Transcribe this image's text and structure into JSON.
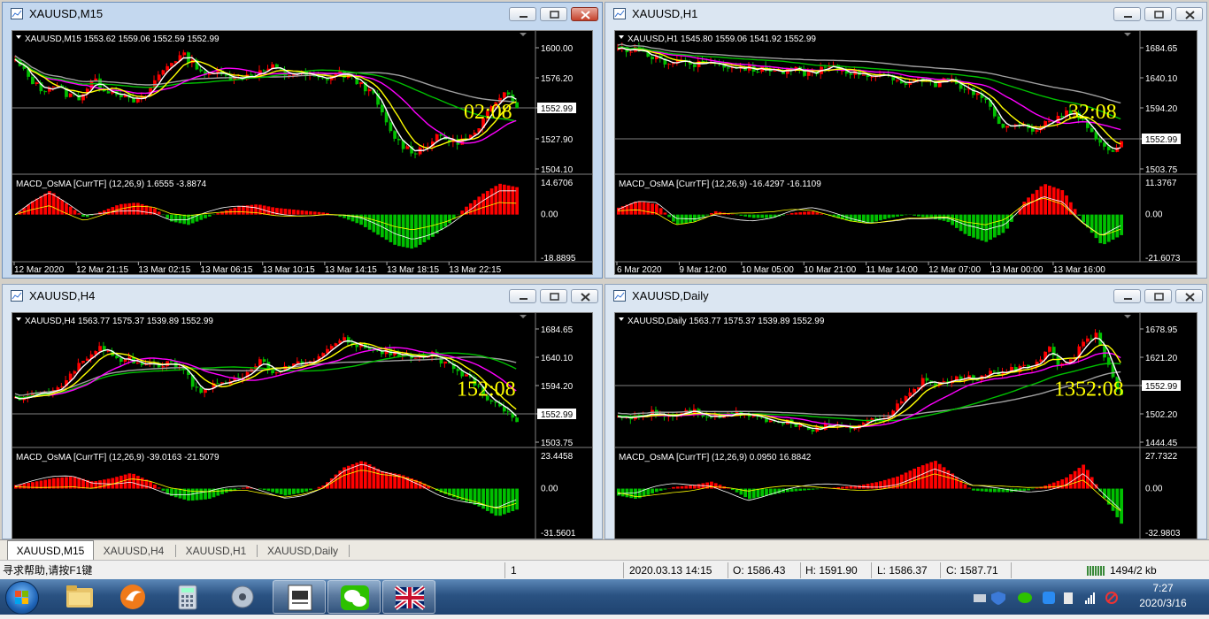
{
  "windows": [
    {
      "title": "XAUUSD,M15",
      "info": "XAUUSD,M15  1553.62 1559.06 1552.59 1552.99",
      "price_labels": [
        "1600.00",
        "1576.20",
        "1552.99",
        "1527.90",
        "1504.10"
      ],
      "current_price": "1552.99",
      "countdown": "02:08",
      "macd_label": "MACD_OsMA [CurrTF] (12,26,9) 1.6555 -3.8874",
      "macd_labels": [
        "14.6706",
        "0.00",
        "-18.8895"
      ],
      "time_labels": [
        "12 Mar 2020",
        "12 Mar 21:15",
        "13 Mar 02:15",
        "13 Mar 06:15",
        "13 Mar 10:15",
        "13 Mar 14:15",
        "13 Mar 18:15",
        "13 Mar 22:15"
      ]
    },
    {
      "title": "XAUUSD,H1",
      "info": "XAUUSD,H1  1545.80 1559.06 1541.92 1552.99",
      "price_labels": [
        "1684.65",
        "1640.10",
        "1594.20",
        "1552.99",
        "1503.75"
      ],
      "current_price": "1552.99",
      "countdown": "32:08",
      "macd_label": "MACD_OsMA [CurrTF] (12,26,9) -16.4297 -16.1109",
      "macd_labels": [
        "11.3767",
        "0.00",
        "-21.6073"
      ],
      "time_labels": [
        "6 Mar 2020",
        "9 Mar 12:00",
        "10 Mar 05:00",
        "10 Mar 21:00",
        "11 Mar 14:00",
        "12 Mar 07:00",
        "13 Mar 00:00",
        "13 Mar 16:00"
      ]
    },
    {
      "title": "XAUUSD,H4",
      "info": "XAUUSD,H4  1563.77 1575.37 1539.89 1552.99",
      "price_labels": [
        "1684.65",
        "1640.10",
        "1594.20",
        "1552.99",
        "1503.75"
      ],
      "current_price": "1552.99",
      "countdown": "152:08",
      "macd_label": "MACD_OsMA [CurrTF] (12,26,9) -39.0163 -21.5079",
      "macd_labels": [
        "23.4458",
        "0.00",
        "-31.5601"
      ],
      "time_labels": []
    },
    {
      "title": "XAUUSD,Daily",
      "info": "XAUUSD,Daily  1563.77 1575.37 1539.89 1552.99",
      "price_labels": [
        "1678.95",
        "1621.20",
        "1552.99",
        "1502.20",
        "1444.45"
      ],
      "current_price": "1552.99",
      "countdown": "1352:08",
      "macd_label": "MACD_OsMA [CurrTF] (12,26,9) 0.0950 16.8842",
      "macd_labels": [
        "27.7322",
        "0.00",
        "-32.9803"
      ],
      "time_labels": []
    }
  ],
  "tabs": [
    "XAUUSD,M15",
    "XAUUSD,H4",
    "XAUUSD,H1",
    "XAUUSD,Daily"
  ],
  "status": {
    "help": "寻求帮助,请按F1键",
    "profile": "1",
    "datetime": "2020.03.13 14:15",
    "open": "O: 1586.43",
    "high": "H: 1591.90",
    "low": "L: 1586.37",
    "close": "C: 1587.71",
    "traffic": "1494/2 kb"
  },
  "taskbar": {
    "time": "7:27",
    "date": "2020/3/16"
  },
  "colors": {
    "bull": "#ff0000",
    "bear": "#00c000",
    "ma_fast": "#ffffff",
    "ma_mid": "#ffff00",
    "ma_slow": "#ff00ff",
    "ma_long": "#00c000",
    "ma_longest": "#a0a0a0",
    "countdown": "#ffff00",
    "background": "#000000"
  }
}
